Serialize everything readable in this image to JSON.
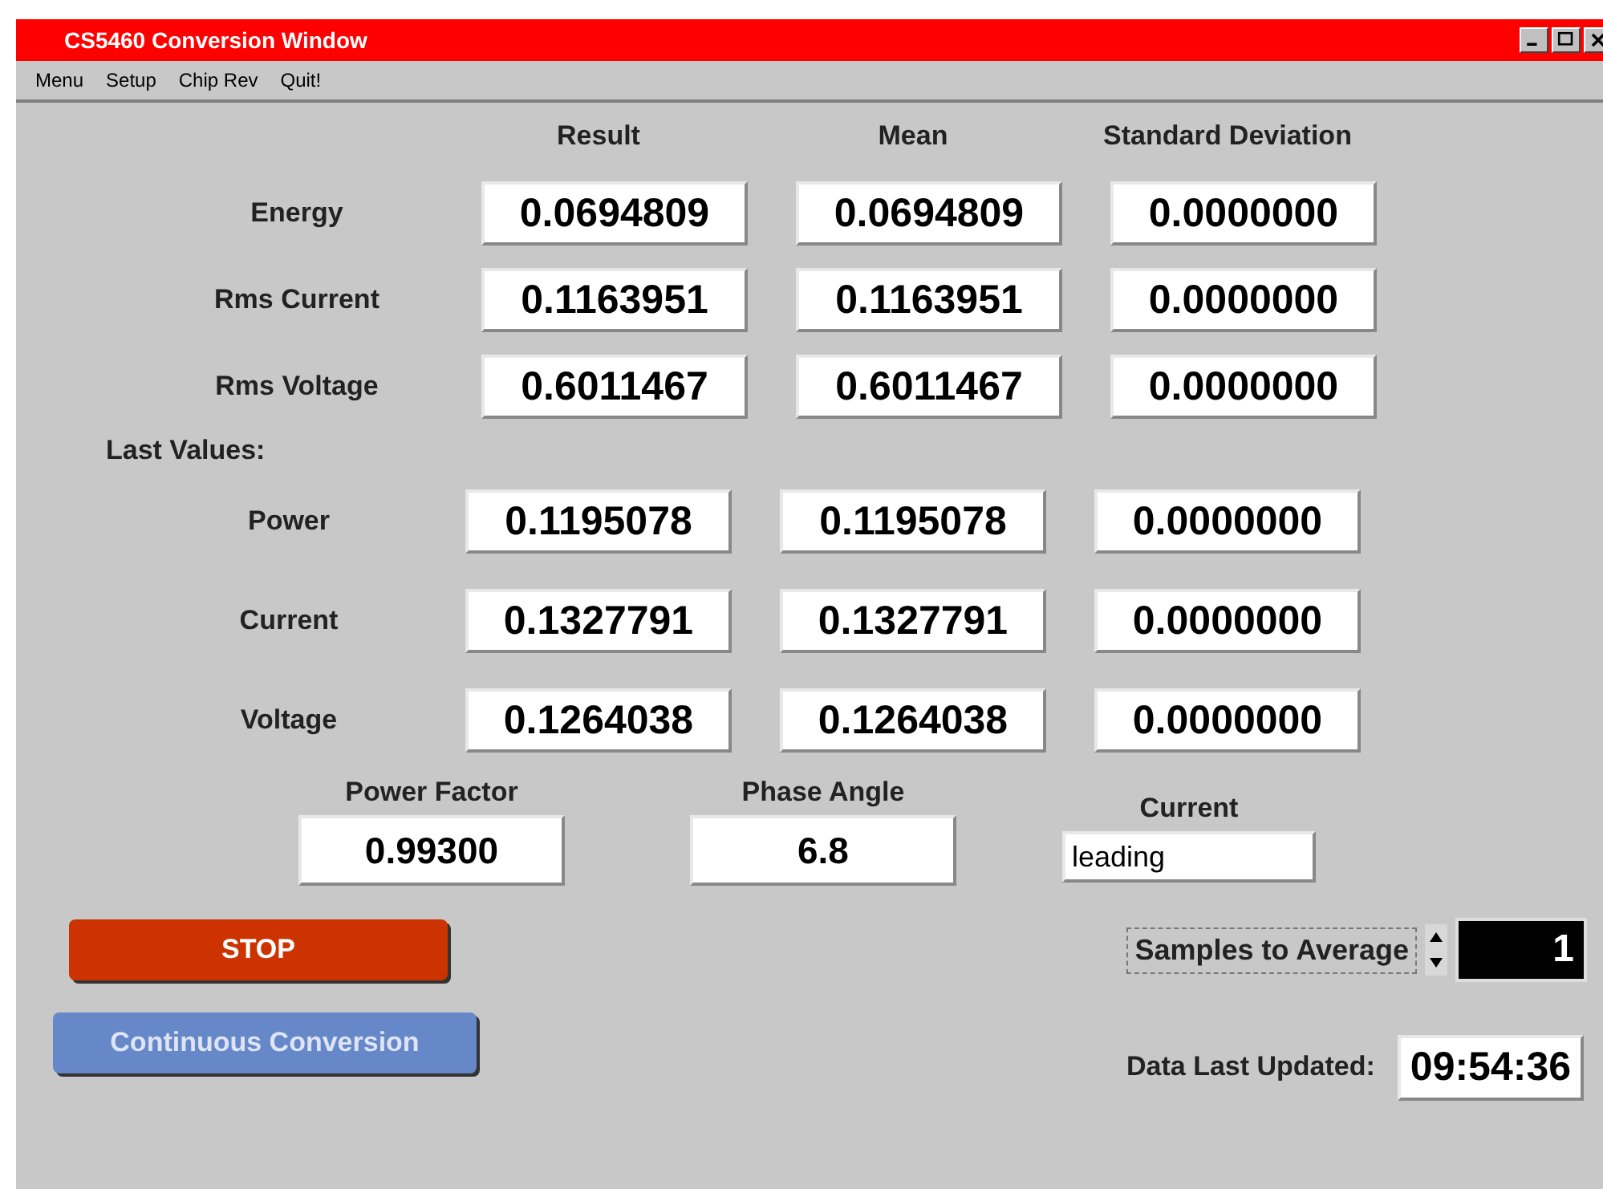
{
  "window": {
    "title": "CS5460 Conversion Window"
  },
  "menu": [
    "Menu",
    "Setup",
    "Chip Rev",
    "Quit!"
  ],
  "columns": [
    "Result",
    "Mean",
    "Standard Deviation"
  ],
  "measurements": [
    {
      "label": "Energy",
      "values": [
        "0.0694809",
        "0.0694809",
        "0.0000000"
      ]
    },
    {
      "label": "Rms Current",
      "values": [
        "0.1163951",
        "0.1163951",
        "0.0000000"
      ]
    },
    {
      "label": "Rms Voltage",
      "values": [
        "0.6011467",
        "0.6011467",
        "0.0000000"
      ]
    }
  ],
  "last_values": {
    "title": "Last Values:",
    "rows": [
      {
        "label": "Power",
        "values": [
          "0.1195078",
          "0.1195078",
          "0.0000000"
        ]
      },
      {
        "label": "Current",
        "values": [
          "0.1327791",
          "0.1327791",
          "0.0000000"
        ]
      },
      {
        "label": "Voltage",
        "values": [
          "0.1264038",
          "0.1264038",
          "0.0000000"
        ]
      }
    ]
  },
  "indicators": [
    {
      "label": "Power Factor",
      "value": "0.99300",
      "kind": "number"
    },
    {
      "label": "Phase Angle",
      "value": "6.8",
      "kind": "number"
    },
    {
      "label": "Current",
      "value": "leading",
      "kind": "text"
    }
  ],
  "buttons": [
    {
      "label": "STOP",
      "color": "#cc3300"
    },
    {
      "label": "Continuous Conversion",
      "color": "#6688c8"
    }
  ],
  "samples": {
    "label": "Samples to Average",
    "value": "1"
  },
  "updated": {
    "label": "Data Last Updated:",
    "value": "09:54:36"
  }
}
